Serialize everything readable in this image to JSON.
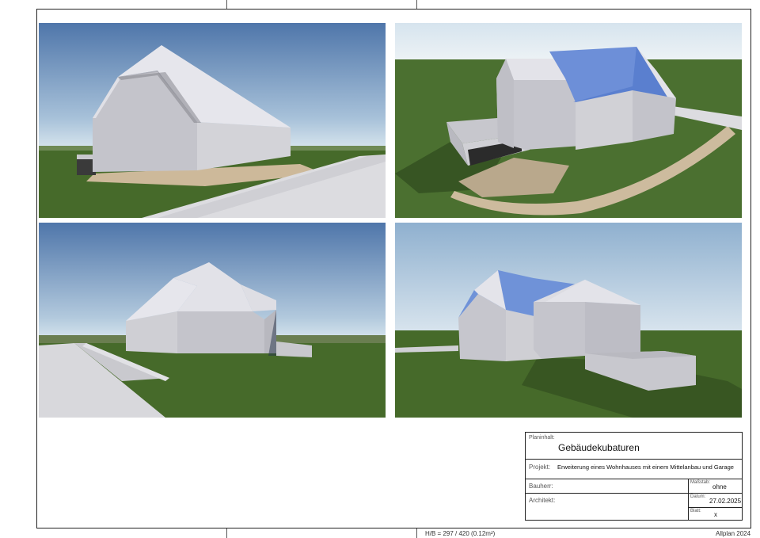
{
  "title_block": {
    "planinhalt_label": "Planinhalt:",
    "planinhalt_value": "Gebäudekubaturen",
    "projekt_label": "Projekt:",
    "projekt_value": "Erweiterung eines Wohnhauses mit einem Mittelanbau und Garage",
    "bauherr_label": "Bauherr:",
    "massstab_label": "Maßstab:",
    "massstab_value": "ohne",
    "architekt_label": "Architekt:",
    "datum_label": "Datum:",
    "datum_value": "27.02.2025",
    "blatt_label": "Blatt:",
    "blatt_value": "x"
  },
  "footer": {
    "format": "H/B = 297 / 420 (0.12m²)",
    "software": "Allplan 2024"
  },
  "renders": [
    {
      "name": "render-view-1"
    },
    {
      "name": "render-view-2"
    },
    {
      "name": "render-view-3"
    },
    {
      "name": "render-view-4"
    }
  ],
  "colors": {
    "sky_top": "#4d74a8",
    "sky_bottom": "#cfe0ea",
    "grass": "#466a2a",
    "wall": "#c9c9cf",
    "roof": "#e4e4ea",
    "path": "#cdb99a"
  }
}
